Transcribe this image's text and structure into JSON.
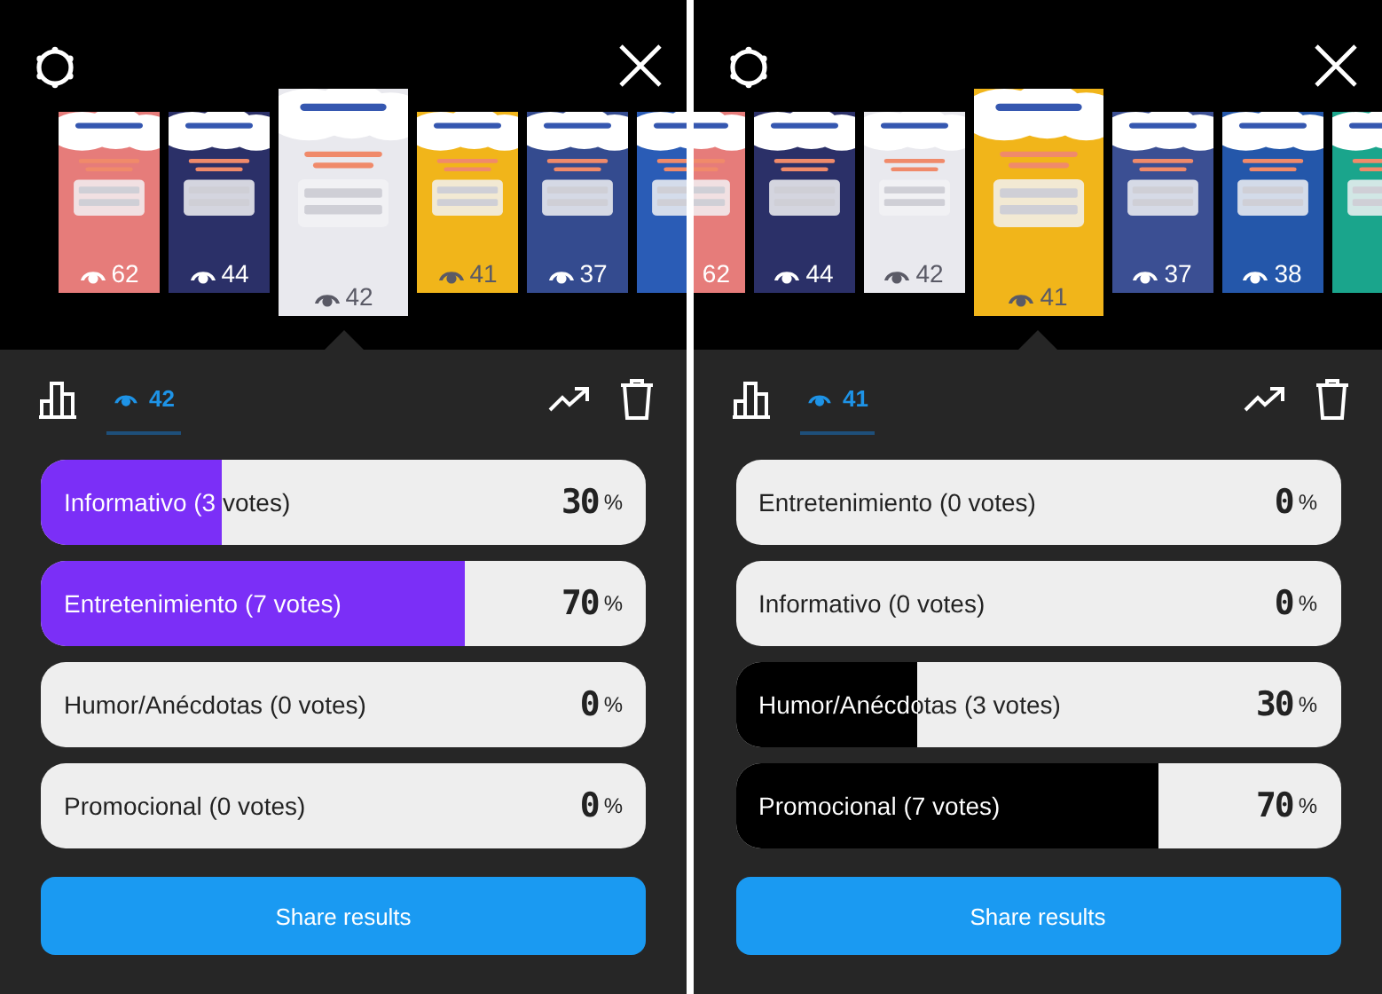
{
  "panels": [
    {
      "color": "#7b2ff7",
      "thumbnails": [
        {
          "color": "#e67c7a",
          "count": "62",
          "selected": false
        },
        {
          "color": "#2b3068",
          "count": "44",
          "selected": false
        },
        {
          "color": "#e9e9ee",
          "count": "42",
          "selected": true
        },
        {
          "color": "#f1b51a",
          "count": "41",
          "selected": false
        },
        {
          "color": "#344b8f",
          "count": "37",
          "selected": false
        },
        {
          "color": "#2a5cb6",
          "selected": false
        }
      ],
      "tabs": [
        {
          "kind": "chart",
          "selected": false
        },
        {
          "kind": "viewers",
          "label": "42",
          "selected": true
        }
      ],
      "options": [
        {
          "label": "Informativo (3 votes)",
          "percent": "30",
          "unit": "%",
          "level": 0.3
        },
        {
          "label": "Entretenimiento (7 votes)",
          "percent": "70",
          "unit": "%",
          "level": 0.7
        },
        {
          "label": "Humor/Anécdotas (0 votes)",
          "percent": "0",
          "unit": "%",
          "level": 0
        },
        {
          "label": "Promocional (0 votes)",
          "percent": "0",
          "unit": "%",
          "level": 0
        }
      ],
      "share_button": "Share results"
    },
    {
      "color": "#000000",
      "thumbnails": [
        {
          "color": "#e67c7a",
          "count": "62",
          "selected": false
        },
        {
          "color": "#2b3068",
          "count": "44",
          "selected": false
        },
        {
          "color": "#e9e9ee",
          "count": "42",
          "selected": false
        },
        {
          "color": "#f1b51a",
          "count": "41",
          "selected": true
        },
        {
          "color": "#3b4f93",
          "count": "37",
          "selected": false
        },
        {
          "color": "#2457aa",
          "count": "38",
          "selected": false
        },
        {
          "color": "#1aa58c",
          "selected": false
        }
      ],
      "tabs": [
        {
          "kind": "chart",
          "selected": false
        },
        {
          "kind": "viewers",
          "label": "41",
          "selected": true
        }
      ],
      "options": [
        {
          "label": "Entretenimiento (0 votes)",
          "percent": "0",
          "unit": "%",
          "level": 0
        },
        {
          "label": "Informativo (0 votes)",
          "percent": "0",
          "unit": "%",
          "level": 0
        },
        {
          "label": "Humor/Anécdotas (3 votes)",
          "percent": "30",
          "unit": "%",
          "level": 0.3
        },
        {
          "label": "Promocional (7 votes)",
          "percent": "70",
          "unit": "%",
          "level": 0.7
        }
      ],
      "share_button": "Share results"
    }
  ]
}
